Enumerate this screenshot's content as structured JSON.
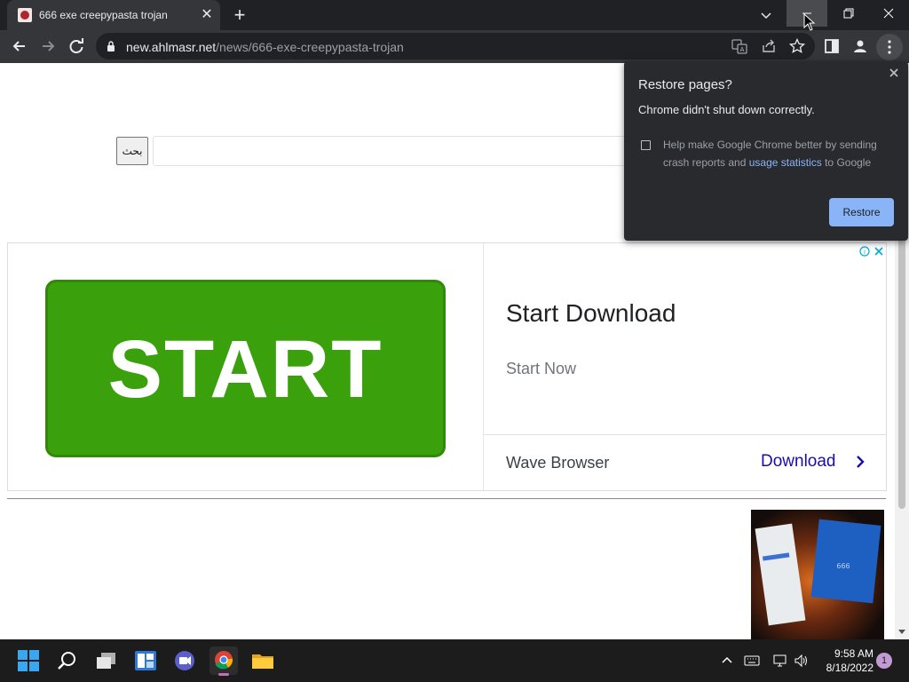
{
  "tab": {
    "title": "666 exe creepypasta trojan",
    "close_glyph": "✕"
  },
  "newtab_glyph": "+",
  "toolbar": {
    "url_host": "new.ahlmasr.net",
    "url_path": "/news/666-exe-creepypasta-trojan"
  },
  "page": {
    "search_button_label": "بحث",
    "search_input_value": ""
  },
  "ad": {
    "image_button_text": "START",
    "headline": "Start Download",
    "subline": "Start Now",
    "advertiser": "Wave Browser",
    "cta": "Download"
  },
  "popup": {
    "title": "Restore pages?",
    "message": "Chrome didn't shut down correctly.",
    "checkbox_text_before": "Help make Google Chrome better by sending crash reports and ",
    "checkbox_link": "usage statistics",
    "checkbox_text_after": " to Google",
    "restore_label": "Restore"
  },
  "taskbar": {
    "time": "9:58 AM",
    "date": "8/18/2022",
    "notification_count": "1"
  },
  "icons": {
    "tab_favicon": "site-favicon",
    "back": "back-arrow-icon",
    "forward": "forward-arrow-icon",
    "reload": "reload-icon",
    "lock": "lock-icon",
    "translate": "translate-icon",
    "share": "share-icon",
    "bookmark": "star-icon",
    "sidepanel": "side-panel-icon",
    "profile": "profile-icon",
    "menu": "kebab-menu-icon"
  },
  "colors": {
    "chrome_dark": "#202124",
    "toolbar": "#35363a",
    "start_green": "#3aa00c",
    "cta_blue": "#1a0dab",
    "restore_blue": "#8ab4f8"
  }
}
